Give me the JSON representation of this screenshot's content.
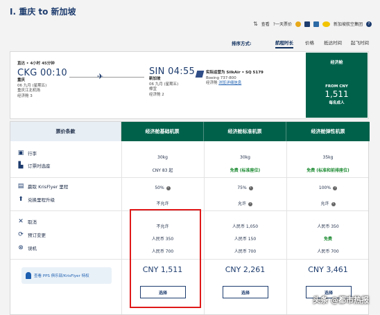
{
  "page": {
    "title": "I. 重庆 to 新加坡"
  },
  "top_util": {
    "view_text": "查看",
    "prev_text": "?一天票价",
    "airline_group_text": "新加坡航空集团"
  },
  "sort": {
    "label": "排序方式:",
    "options": [
      "航程时长",
      "价格",
      "抵达时间",
      "起飞时间"
    ],
    "active_index": 0
  },
  "flight": {
    "tag": "直达 • 4小时 45分钟",
    "depart_time": "CKG 00:10",
    "depart_city": "重庆",
    "depart_date": "06 九月 (星期五)",
    "depart_airport": "重庆江北机场",
    "depart_terminal": "经济舱 3",
    "arrive_time": "SIN 04:55",
    "arrive_city": "新加坡",
    "arrive_date": "06 九月 (星期五)",
    "arrive_airport": "樟宜",
    "arrive_terminal": "经济舱 2",
    "operator": "实际运营为 SilkAir • SQ 5179",
    "aircraft": "Boeing 737-800",
    "cabin_label": "经济舱",
    "detail_link": "浏览详细信息"
  },
  "fare_tile": {
    "cabin": "经济舱",
    "from_label": "FROM CNY",
    "amount": "1,511",
    "per_label": "每名成人"
  },
  "compare": {
    "condition_header": "票价条款",
    "columns": [
      {
        "name": "经济舱基础机票",
        "baggage": "30kg",
        "seat": "CNY 83 起",
        "miles": "50%",
        "upgrade": "不允许",
        "cancel": "不允许",
        "change": "人民币 350",
        "noshow": "人民币 700",
        "price": "CNY 1,511",
        "select": "选择"
      },
      {
        "name": "经济舱标准机票",
        "baggage": "30kg",
        "seat": "免费 (标准座位)",
        "miles": "75%",
        "upgrade": "允许",
        "cancel": "人民币 1,050",
        "change": "人民币 150",
        "noshow": "人民币 700",
        "price": "CNY 2,261",
        "select": "选择"
      },
      {
        "name": "经济舱弹性机票",
        "baggage": "35kg",
        "seat": "免费 (标准和前排座位)",
        "miles": "100%",
        "upgrade": "允许",
        "cancel": "人民币 350",
        "change": "免费",
        "noshow": "人民币 700",
        "price": "CNY 3,461",
        "select": "选择"
      }
    ],
    "labels": {
      "baggage": "行李",
      "seat": "订票时选座",
      "miles": "赢取 KrisFlyer 里程",
      "upgrade": "兑换里程升级",
      "cancel": "取消",
      "change": "预订变更",
      "noshow": "误机"
    },
    "kf_link": "查看 PPS 俱乐部/KrisFlyer 特权"
  },
  "watermark": "头条 @都市热报",
  "colors": {
    "accent": "#00614b",
    "navy": "#1d3c6e",
    "green_text": "#1a8a30",
    "highlight": "#e01818"
  }
}
